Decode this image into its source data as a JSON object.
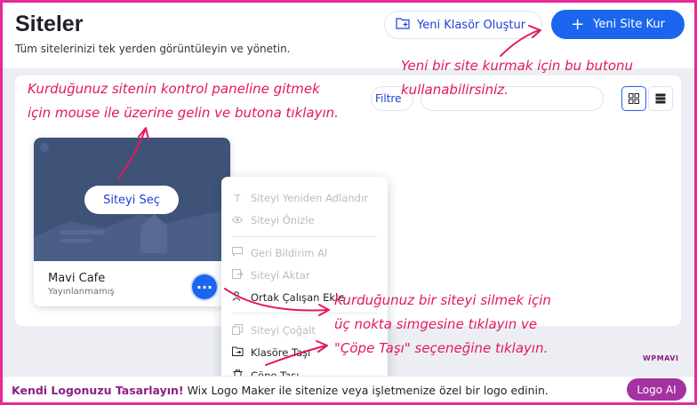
{
  "header": {
    "title": "Siteler",
    "subtitle": "Tüm sitelerinizi tek yerden görüntüleyin ve yönetin.",
    "new_folder_label": "Yeni Klasör Oluştur",
    "new_site_label": "Yeni Site Kur",
    "accent_color": "#1c66ef"
  },
  "toolbar": {
    "filter_label": "Filtre",
    "grid_view_icon": "grid-view-icon",
    "list_view_icon": "list-view-icon"
  },
  "site_card": {
    "name": "Mavi Cafe",
    "status": "Yayınlanmamış",
    "select_label": "Siteyi Seç",
    "more_icon": "three-dots-icon"
  },
  "context_menu": {
    "items": [
      {
        "label": "Siteyi Yeniden Adlandır",
        "icon": "text-icon",
        "enabled": false
      },
      {
        "label": "Siteyi Önizle",
        "icon": "eye-icon",
        "enabled": false
      },
      {
        "label": "Geri Bildirim Al",
        "icon": "comment-icon",
        "enabled": false
      },
      {
        "label": "Siteyi Aktar",
        "icon": "transfer-icon",
        "enabled": false
      },
      {
        "label": "Ortak Çalışan Ekle",
        "icon": "user-add-icon",
        "enabled": true
      },
      {
        "label": "Siteyi Çoğalt",
        "icon": "duplicate-icon",
        "enabled": false
      },
      {
        "label": "Klasöre Taşı",
        "icon": "move-folder-icon",
        "enabled": true
      },
      {
        "label": "Çöpe Taşı",
        "icon": "trash-icon",
        "enabled": true
      }
    ]
  },
  "bottom_bar": {
    "promo_title": "Kendi Logonuzu Tasarlayın!",
    "promo_text": "Wix Logo Maker ile sitenize veya işletmenize özel bir logo edinin.",
    "logo_button_label": "Logo AI"
  },
  "annotations": {
    "new_site_tip": "Yeni bir site kurmak için bu butonu",
    "new_site_tip_2": "kullanabilirsiniz.",
    "control_panel_tip": "Kurduğunuz sitenin kontrol paneline gitmek",
    "control_panel_tip_2": "için mouse ile üzerine gelin ve butona tıklayın.",
    "delete_tip": "Kurduğunuz bir siteyi silmek için",
    "delete_tip_2": "üç nokta simgesine tıklayın ve",
    "delete_tip_3": "\"Çöpe Taşı\" seçeneğine tıklayın.",
    "annotation_color": "#e3185d"
  },
  "watermark": "WPMAVI",
  "colors": {
    "frame_border": "#e6299b",
    "background": "#eceef3",
    "card_thumb": "#3f5278",
    "promo_accent": "#a432a0"
  }
}
